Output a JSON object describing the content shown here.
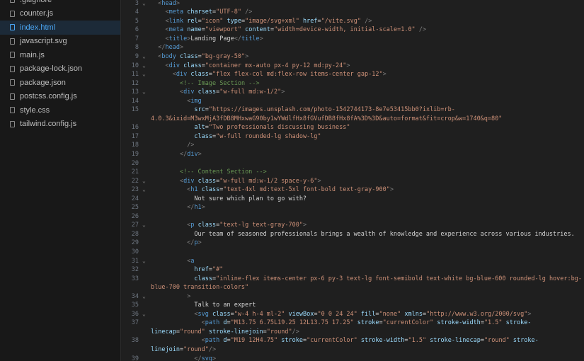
{
  "sidebar": {
    "files": [
      {
        "name": ".gitignore"
      },
      {
        "name": "counter.js"
      },
      {
        "name": "index.html",
        "selected": true
      },
      {
        "name": "javascript.svg"
      },
      {
        "name": "main.js"
      },
      {
        "name": "package-lock.json"
      },
      {
        "name": "package.json"
      },
      {
        "name": "postcss.config.js"
      },
      {
        "name": "style.css"
      },
      {
        "name": "tailwind.config.js"
      }
    ]
  },
  "colors": {
    "tag": "#569cd6",
    "attr": "#9cdcfe",
    "string": "#ce9178",
    "comment": "#6a9955",
    "selected_file": "#4aa6f4"
  },
  "editor": {
    "lines": [
      {
        "n": "3",
        "fold": true,
        "text": "  <head>"
      },
      {
        "n": "4",
        "text": "    <meta charset=\"UTF-8\" />"
      },
      {
        "n": "5",
        "text": "    <link rel=\"icon\" type=\"image/svg+xml\" href=\"/vite.svg\" />"
      },
      {
        "n": "6",
        "text": "    <meta name=\"viewport\" content=\"width=device-width, initial-scale=1.0\" />"
      },
      {
        "n": "7",
        "text": "    <title>Landing Page</title>"
      },
      {
        "n": "8",
        "text": "  </head>"
      },
      {
        "n": "9",
        "fold": true,
        "text": "  <body class=\"bg-gray-50\">"
      },
      {
        "n": "10",
        "fold": true,
        "text": "    <div class=\"container mx-auto px-4 py-12 md:py-24\">"
      },
      {
        "n": "11",
        "fold": true,
        "text": "      <div class=\"flex flex-col md:flex-row items-center gap-12\">"
      },
      {
        "n": "12",
        "text": "        <!-- Image Section -->"
      },
      {
        "n": "13",
        "fold": true,
        "text": "        <div class=\"w-full md:w-1/2\">"
      },
      {
        "n": "14",
        "text": "          <img"
      },
      {
        "n": "15",
        "text": "            src=\"https://images.unsplash.com/photo-1542744173-8e7e53415bb0?ixlib=rb-"
      },
      {
        "n": "",
        "text": "4.0.3&ixid=M3wxMjA3fDB8MHxwaG90by1wYWdlfHx8fGVufDB8fHx8fA%3D%3D&auto=format&fit=crop&w=1740&q=80\""
      },
      {
        "n": "16",
        "text": "            alt=\"Two professionals discussing business\""
      },
      {
        "n": "17",
        "text": "            class=\"w-full rounded-lg shadow-lg\""
      },
      {
        "n": "18",
        "text": "          />"
      },
      {
        "n": "19",
        "text": "        </div>"
      },
      {
        "n": "20",
        "text": ""
      },
      {
        "n": "21",
        "text": "        <!-- Content Section -->"
      },
      {
        "n": "22",
        "fold": true,
        "text": "        <div class=\"w-full md:w-1/2 space-y-6\">"
      },
      {
        "n": "23",
        "fold": true,
        "text": "          <h1 class=\"text-4xl md:text-5xl font-bold text-gray-900\">"
      },
      {
        "n": "24",
        "text": "            Not sure which plan to go with?"
      },
      {
        "n": "25",
        "text": "          </h1>"
      },
      {
        "n": "26",
        "text": ""
      },
      {
        "n": "27",
        "fold": true,
        "text": "          <p class=\"text-lg text-gray-700\">"
      },
      {
        "n": "28",
        "text": "            Our team of seasoned professionals brings a wealth of knowledge and experience across various industries."
      },
      {
        "n": "29",
        "text": "          </p>"
      },
      {
        "n": "30",
        "text": ""
      },
      {
        "n": "31",
        "fold": true,
        "text": "          <a"
      },
      {
        "n": "32",
        "text": "            href=\"#\""
      },
      {
        "n": "33",
        "text": "            class=\"inline-flex items-center px-6 py-3 text-lg font-semibold text-white bg-blue-600 rounded-lg hover:bg-"
      },
      {
        "n": "",
        "text": "blue-700 transition-colors\""
      },
      {
        "n": "34",
        "fold": true,
        "text": "          >"
      },
      {
        "n": "35",
        "text": "            Talk to an expert"
      },
      {
        "n": "36",
        "fold": true,
        "text": "            <svg class=\"w-4 h-4 ml-2\" viewBox=\"0 0 24 24\" fill=\"none\" xmlns=\"http://www.w3.org/2000/svg\">"
      },
      {
        "n": "37",
        "text": "              <path d=\"M13.75 6.75L19.25 12L13.75 17.25\" stroke=\"currentColor\" stroke-width=\"1.5\" stroke-"
      },
      {
        "n": "",
        "text": "linecap=\"round\" stroke-linejoin=\"round\"/>"
      },
      {
        "n": "38",
        "text": "              <path d=\"M19 12H4.75\" stroke=\"currentColor\" stroke-width=\"1.5\" stroke-linecap=\"round\" stroke-"
      },
      {
        "n": "",
        "text": "linejoin=\"round\"/>"
      },
      {
        "n": "39",
        "text": "            </svg>"
      }
    ]
  }
}
